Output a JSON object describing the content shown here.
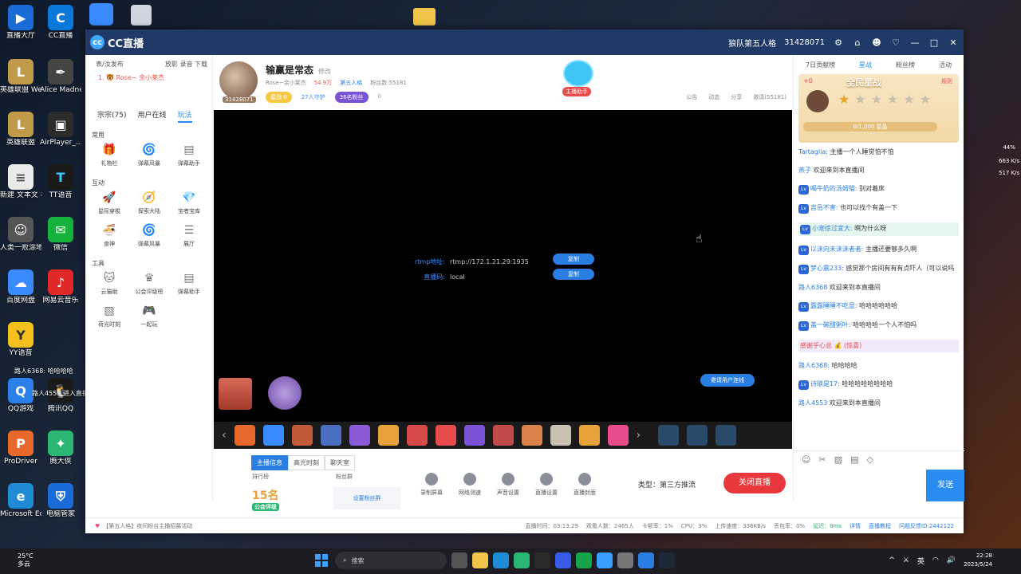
{
  "desktop": {
    "icons": [
      {
        "label": "直播大厅",
        "color": "#1a6bd6"
      },
      {
        "label": "CC直播",
        "color": "#0a78d8"
      },
      {
        "label": "英雄联盟 WeGame版",
        "color": "#c09a4a"
      },
      {
        "label": "Alice Madne...",
        "color": "#444"
      },
      {
        "label": "英雄联盟",
        "color": "#c09a4a"
      },
      {
        "label": "AirPlayer_...",
        "color": "#2b2b2b"
      },
      {
        "label": "新建 文本文 档",
        "color": "#eaeaea"
      },
      {
        "label": "TT语音",
        "color": "#1a1a1a"
      },
      {
        "label": "人类一败涂地 Human Fa...",
        "color": "#555"
      },
      {
        "label": "微信",
        "color": "#16b33c"
      },
      {
        "label": "百度网盘",
        "color": "#3a8bff"
      },
      {
        "label": "网易云音乐",
        "color": "#e02828"
      },
      {
        "label": "YY语音",
        "color": "#f4c01e"
      },
      {
        "label": "QQ游戏",
        "color": "#2a80e8"
      },
      {
        "label": "腾讯QQ",
        "color": "#1b1b1b"
      },
      {
        "label": "ProDriver",
        "color": "#e8672a"
      },
      {
        "label": "腾大侠",
        "color": "#2bb673"
      },
      {
        "label": "Microsoft Edge",
        "color": "#1f8bd6"
      },
      {
        "label": "电脑管家",
        "color": "#1a6bd6"
      }
    ],
    "overlay_texts": [
      "路人6368: 哈哈哈哈",
      "路人4553 进入直播间"
    ]
  },
  "window": {
    "app_title": "CC直播",
    "game_title": "狼队第五人格",
    "room_number": "31428071",
    "left": {
      "top_menu": [
        "表/汝发布",
        "放影 录音 下载"
      ],
      "user_line": "1. 🐯 Rose~ 余小莱杰",
      "tabs": [
        "宗宗(75)",
        "用户在线",
        "玩法"
      ],
      "sections": [
        {
          "title": "常用",
          "tools": [
            "礼物栏",
            "弹幕风暴",
            "弹幕助手"
          ]
        },
        {
          "title": "互动",
          "tools": [
            "星际穿梭",
            "探索大陆",
            "宝者宝库",
            "食神",
            "弹幕风暴",
            "展厅"
          ]
        },
        {
          "title": "工具",
          "tools": [
            "云猫助",
            "公会评级榜",
            "弹幕助手",
            "荷光时刻",
            "一起玩"
          ]
        }
      ]
    },
    "broadcaster": {
      "name": "输赢是常态",
      "edit_label": "修改",
      "room_id": "31428071",
      "meta": [
        "Rose~余小莱杰",
        "54.9万",
        "第五人格",
        "粉丝数:55181"
      ],
      "tags": [
        "星战 0",
        "27人守护",
        "36名粉丝",
        "0"
      ],
      "actions": [
        "公告",
        "动态",
        "分享",
        "邀请(55181)"
      ],
      "mascot_label": "主播助手"
    },
    "stream": {
      "rtmp_label": "rtmp地址:",
      "rtmp_value": "rtmp://172.1.21.29:1935",
      "key_label": "直播码:",
      "key_value": "local",
      "copy_label": "复制",
      "link_label": "邀请用户连线"
    },
    "control": {
      "tabs": [
        "主播信息",
        "高光时刻",
        "聊天室"
      ],
      "rank_label": "排行榜",
      "fans_label": "粉丝群",
      "rank_value": "15名",
      "rank_sub": "公会评级",
      "fan_set_label": "设置粉丝群",
      "tools": [
        "录制屏幕",
        "网络测速",
        "声音设置",
        "直播设置",
        "直播封面"
      ],
      "stream_type": "类型：第三方推流",
      "close_label": "关闭直播"
    },
    "right": {
      "tabs": [
        "7日贡献榜",
        "星战",
        "粉丝榜",
        "活动"
      ],
      "star_title": "全民星战",
      "star_plus": "+0",
      "star_rule": "规则",
      "star_progress": "0/1,000 星晶",
      "chat": [
        {
          "name": "Tartaglia:",
          "text": "主播一个人睡觉怕不怕"
        },
        {
          "name": "燕子",
          "text": "欢迎来到本直播间"
        },
        {
          "name": "喝牛奶的汤姆猫:",
          "text": "别对着床"
        },
        {
          "name": "吉岳不害:",
          "text": "也可以找个有盖一下"
        },
        {
          "name": "小宠徐过宜大:",
          "text": "啊为什么呀"
        },
        {
          "name": "以沫向未沫沫者者:",
          "text": "主播还要够多久啊"
        },
        {
          "name": "梦心震233:",
          "text": "感觉那个房间有有有点吓人（可以说吗"
        },
        {
          "name": "路人6368",
          "text": "欢迎来到本直播间"
        },
        {
          "name": "露露睡睡不吃显:",
          "text": "哈哈哈哈哈哈"
        },
        {
          "name": "盖一碗甜粥叶:",
          "text": "哈哈哈哈一个人不怕吗"
        },
        {
          "name": "",
          "text": "感谢乎心总 💰 (惊喜)"
        },
        {
          "name": "路人6368:",
          "text": "哈哈哈哈"
        },
        {
          "name": "诗琅是17:",
          "text": "哈哈哈哈哈哈哈哈"
        },
        {
          "name": "路人4553",
          "text": "欢迎来到本直播间"
        }
      ],
      "send_label": "发送"
    },
    "status": {
      "notice": "【第五人格】夜间粉台主播招募活动",
      "time": "直播时间：03:13:29",
      "viewers": "观看人数：2465人",
      "lag": "卡顿率：1%",
      "cpu": "CPU：3%",
      "upload": "上传速度：336KB/s",
      "loss": "丢包率：0%",
      "delay": "延迟：8ms",
      "detail": "详情",
      "help": "直播教程",
      "feedback": "问题反馈ID:2442122"
    }
  },
  "taskbar": {
    "weather_temp": "25°C",
    "weather_desc": "多云",
    "search_label": "搜索",
    "ime": "英",
    "time": "22:28",
    "date": "2023/5/24"
  },
  "side_net": [
    "44%",
    "663 K/s",
    "517 K/s"
  ]
}
